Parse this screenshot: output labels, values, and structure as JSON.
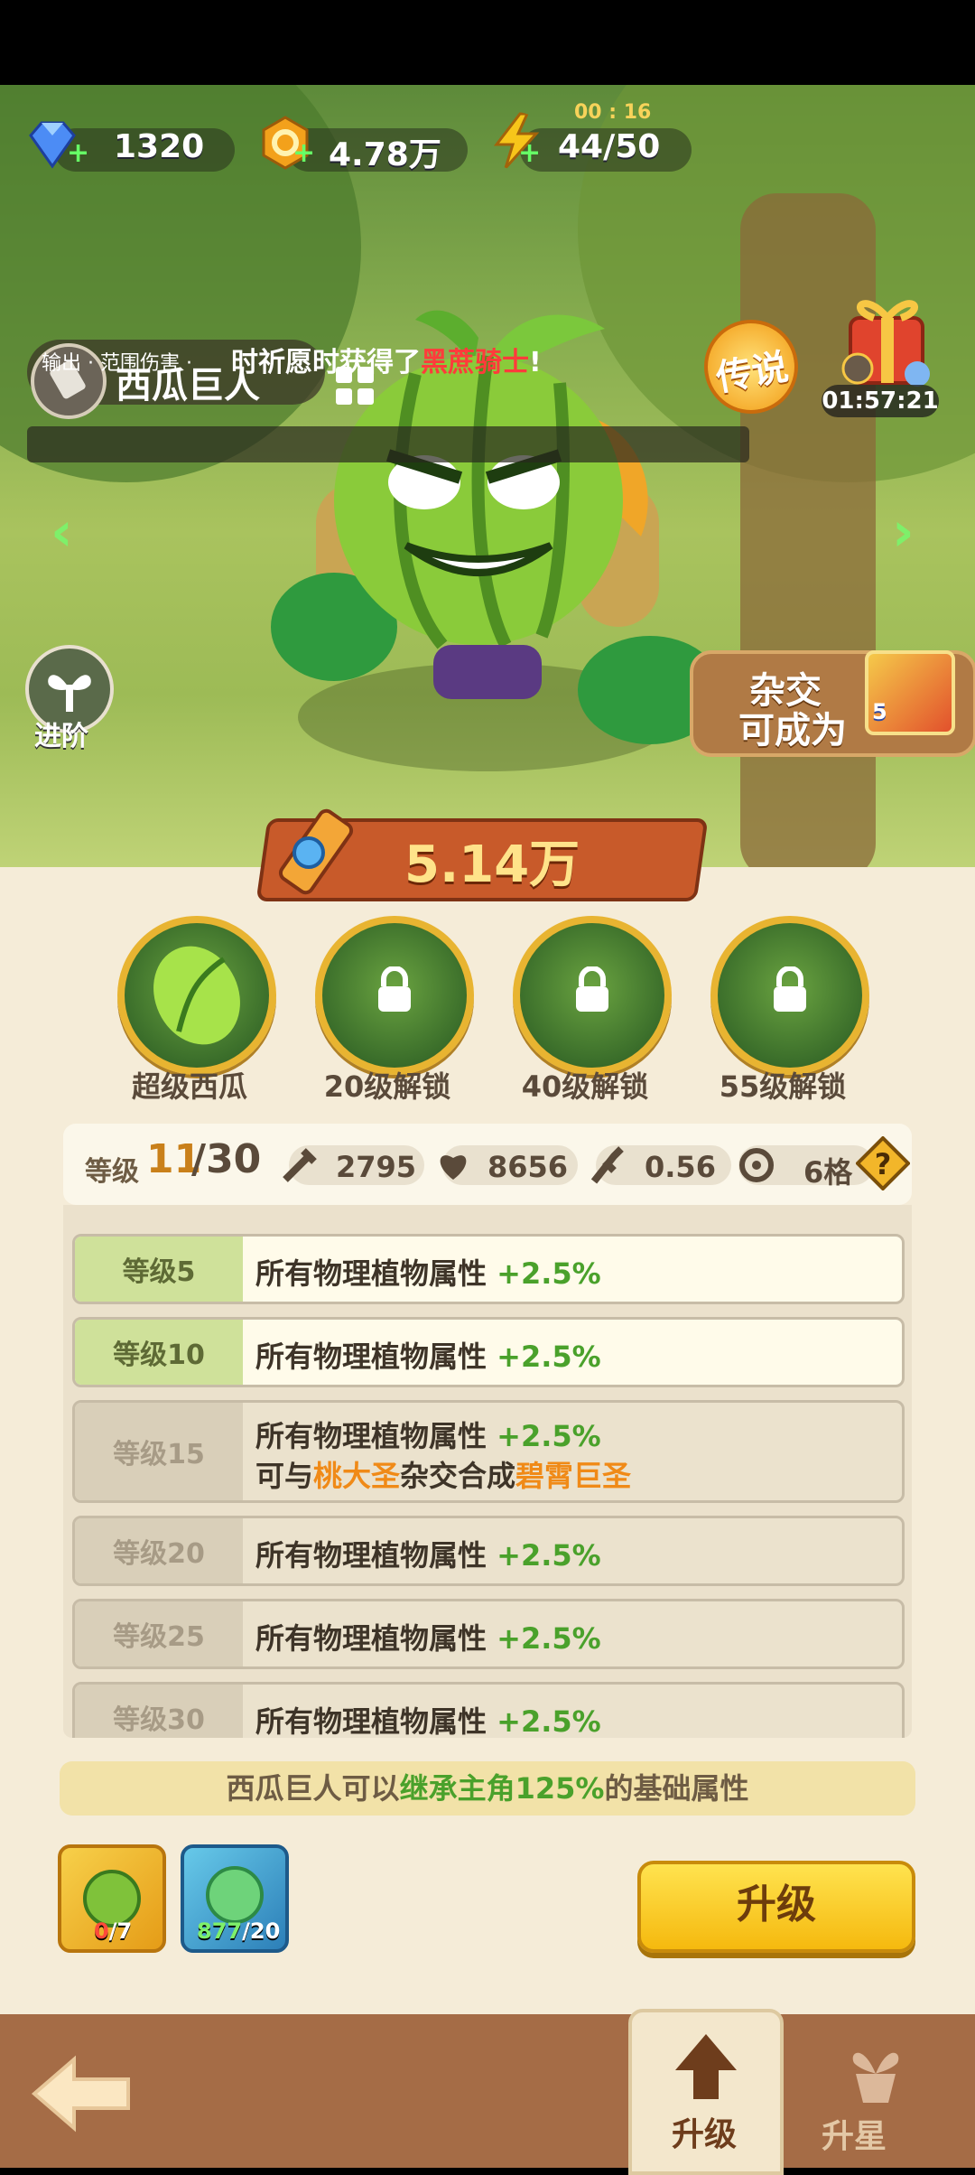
{
  "resources": {
    "gems": "1320",
    "coins": "4.78万",
    "energy_timer": "00 : 16",
    "energy": "44/50"
  },
  "plant": {
    "name": "西瓜巨人",
    "tags": "输出 · 范围伤害 ·",
    "rarity": "传说",
    "power": "5.14万"
  },
  "announcement": {
    "prefix": "时祈愿时获得了",
    "highlight": "黑蔗骑士",
    "suffix": "!"
  },
  "gift": {
    "timer": "01:57:21"
  },
  "buttons": {
    "advance": "进阶",
    "hybrid_line1": "杂交",
    "hybrid_line2": "可成为",
    "hybrid_badge": "5",
    "upgrade": "升级"
  },
  "skills": [
    {
      "label": "超级西瓜",
      "locked": false
    },
    {
      "label": "20级解锁",
      "locked": true
    },
    {
      "label": "40级解锁",
      "locked": true
    },
    {
      "label": "55级解锁",
      "locked": true
    }
  ],
  "stats": {
    "level_label": "等级",
    "level_current": "11",
    "level_max": "/30",
    "attack": "2795",
    "hp": "8656",
    "speed": "0.56",
    "range": "6格"
  },
  "levels": [
    {
      "level": "等级5",
      "text": "所有物理植物属性",
      "bonus": "+2.5%",
      "unlocked": true
    },
    {
      "level": "等级10",
      "text": "所有物理植物属性",
      "bonus": "+2.5%",
      "unlocked": true
    },
    {
      "level": "等级15",
      "text": "所有物理植物属性",
      "bonus": "+2.5%",
      "unlocked": false,
      "extra_prefix": "可与",
      "extra_plant": "桃大圣",
      "extra_mid": "杂交合成",
      "extra_result": "碧霄巨圣"
    },
    {
      "level": "等级20",
      "text": "所有物理植物属性",
      "bonus": "+2.5%",
      "unlocked": false
    },
    {
      "level": "等级25",
      "text": "所有物理植物属性",
      "bonus": "+2.5%",
      "unlocked": false
    },
    {
      "level": "等级30",
      "text": "所有物理植物属性",
      "bonus": "+2.5%",
      "unlocked": false
    }
  ],
  "inherit": {
    "prefix": "西瓜巨人可以",
    "highlight": "继承主角125%",
    "suffix": "的基础属性"
  },
  "items": [
    {
      "have": "0",
      "need": "/7"
    },
    {
      "have": "877",
      "need": "/20"
    }
  ],
  "nav": {
    "upgrade": "升级",
    "star": "升星"
  },
  "colors": {
    "accent_green": "#4aa12b",
    "accent_orange": "#f08a17",
    "button_yellow": "#f5b90e",
    "nav_brown": "#a56c46"
  }
}
